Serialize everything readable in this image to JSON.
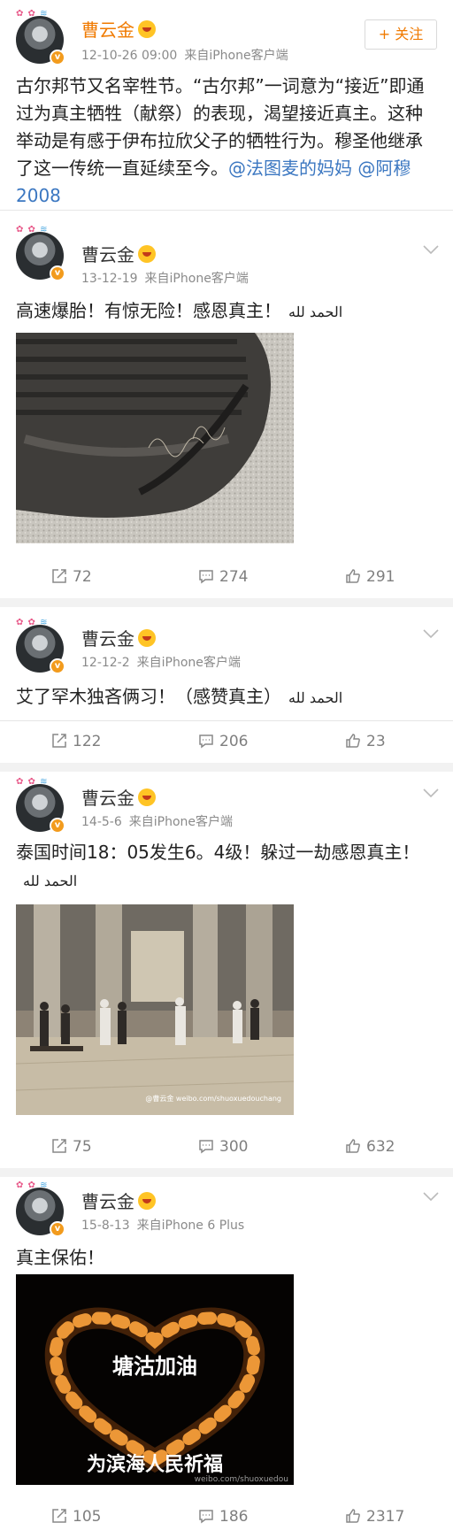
{
  "posts": [
    {
      "author": "曹云金",
      "date": "12-10-26 09:00",
      "source": "来自iPhone客户端",
      "follow_label": "+ 关注",
      "text_before": "古尔邦节又名宰牲节。“古尔邦”一词意为“接近”即通过为真主牺牲（献祭）的表现，渴望接近真主。这种举动是有感于伊布拉欣父子的牺牲行为。穆圣他继承了这一传统一直延续至今。",
      "mention1": "@法图麦的妈妈",
      "mention2": "@阿穆2008"
    },
    {
      "author": "曹云金",
      "date": "13-12-19",
      "source": "来自iPhone客户端",
      "text": "高速爆胎！有惊无险！感恩真主！",
      "arabic": "الحمد لله",
      "shares": "72",
      "comments": "274",
      "likes": "291"
    },
    {
      "author": "曹云金",
      "date": "12-12-2",
      "source": "来自iPhone客户端",
      "text": "艾了罕木独吝俩习！（感赞真主）",
      "arabic": "الحمد لله",
      "shares": "122",
      "comments": "206",
      "likes": "23"
    },
    {
      "author": "曹云金",
      "date": "14-5-6",
      "source": "来自iPhone客户端",
      "text": "泰国时间18：05发生6。4级！躲过一劫感恩真主！",
      "arabic": "الحمد لله",
      "watermark": "@曹云金 weibo.com/shuoxuedouchang",
      "shares": "75",
      "comments": "300",
      "likes": "632"
    },
    {
      "author": "曹云金",
      "date": "15-8-13",
      "source": "来自iPhone 6 Plus",
      "text": "真主保佑！",
      "image_caption_1": "塘沽加油",
      "image_caption_2": "为滨海人民祈福",
      "watermark": "weibo.com/shuoxuedou",
      "shares": "105",
      "comments": "186",
      "likes": "2317"
    }
  ],
  "icons": {
    "share": "share-icon",
    "comment": "comment-icon",
    "like": "thumbs-up-icon",
    "more": "chevron-down-icon"
  },
  "colors": {
    "orange_name": "#f07a00",
    "mention": "#3b77c1",
    "muted": "#8a8a8a"
  }
}
